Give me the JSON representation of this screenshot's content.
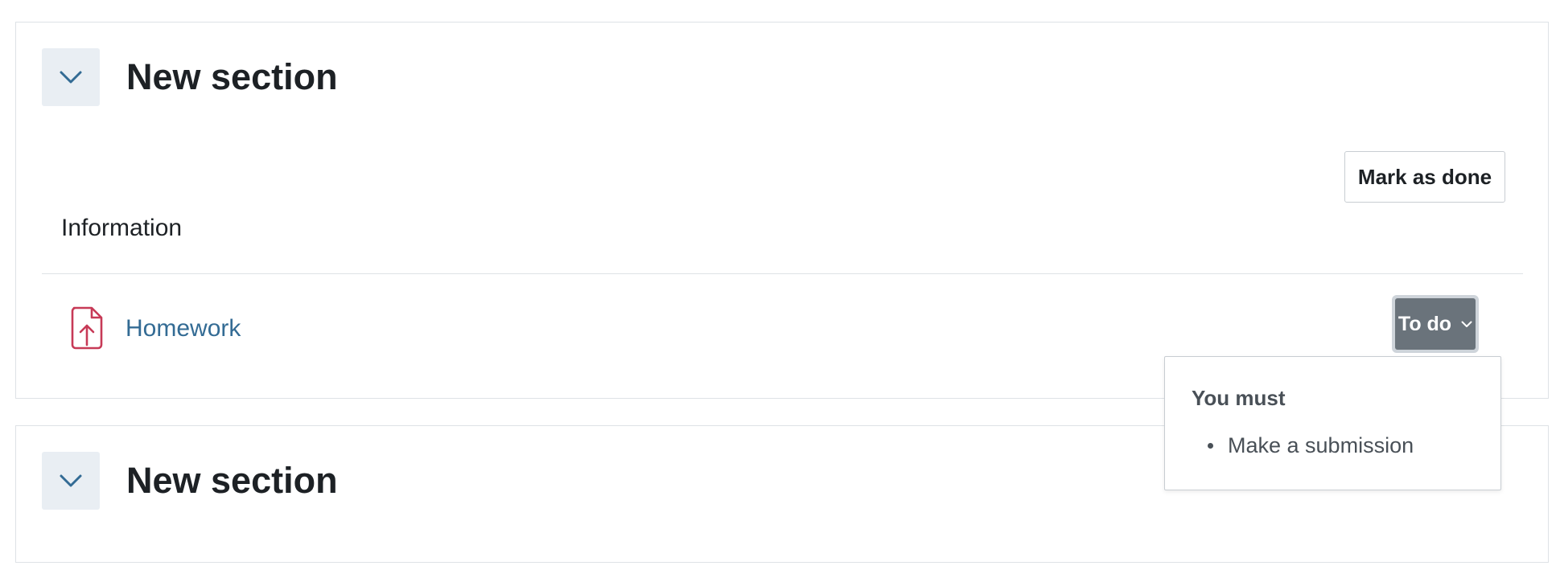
{
  "sections": [
    {
      "title": "New section",
      "mark_done_label": "Mark as done",
      "info_label": "Information",
      "activity": {
        "name": "Homework",
        "icon": "file-upload-icon",
        "completion_label": "To do"
      }
    },
    {
      "title": "New section"
    }
  ],
  "popover": {
    "title": "You must",
    "items": [
      "Make a submission"
    ]
  },
  "colors": {
    "link": "#336b94",
    "icon_accent": "#c73a57",
    "todo_bg": "#6a737b",
    "collapse_bg": "#e9eef3",
    "chevron": "#336b94"
  }
}
